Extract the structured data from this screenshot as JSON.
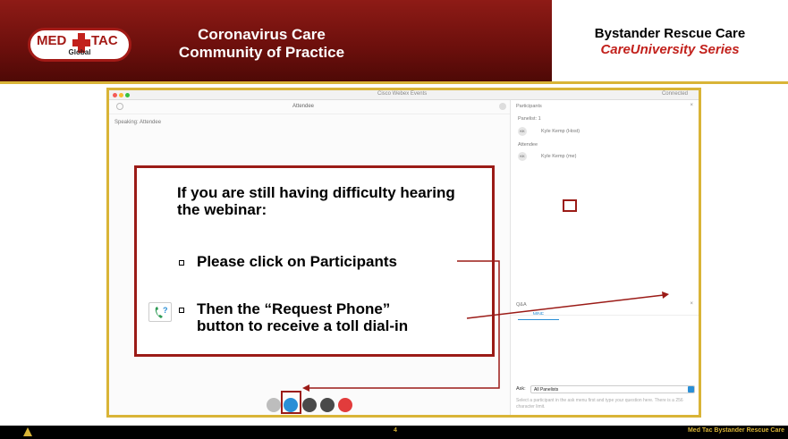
{
  "header": {
    "logo": {
      "left": "MED",
      "right": "TAC",
      "sub": "Global"
    },
    "center_title_line1": "Coronavirus Care",
    "center_title_line2": "Community of Practice",
    "right_title_line1": "Bystander Rescue Care",
    "right_title_line2": "CareUniversity Series"
  },
  "webex": {
    "window_title": "Cisco Webex Events",
    "status": "Connected",
    "attendee_label": "Attendee",
    "speaking": "Speaking: Attendee",
    "participants": {
      "header": "Participants",
      "panelist_group": "Panelist: 1",
      "panelist_name": "Kyle Kemp (Host)",
      "attendee_group": "Attendee",
      "attendee_name": "Kyle Kemp (me)"
    },
    "qa": {
      "header": "Q&A",
      "tab": "MINE",
      "ask_label": "Ask:",
      "ask_value": "All Panelists",
      "help_text": "Select a participant in the ask menu first and type your question here. There is a 256 character limit."
    }
  },
  "callout": {
    "intro": "If you are still having difficulty hearing the webinar:",
    "bullet1": "Please click on Participants",
    "bullet2_line1": "Then the “Request Phone”",
    "bullet2_line2": "button to receive a toll dial-in"
  },
  "footer": {
    "page": "4",
    "right": "Med Tac Bystander Rescue Care"
  },
  "colors": {
    "header_red": "#8e1b16",
    "gold": "#d9b437",
    "callout_border": "#9b1b17",
    "webex_blue": "#2a8fd6"
  }
}
